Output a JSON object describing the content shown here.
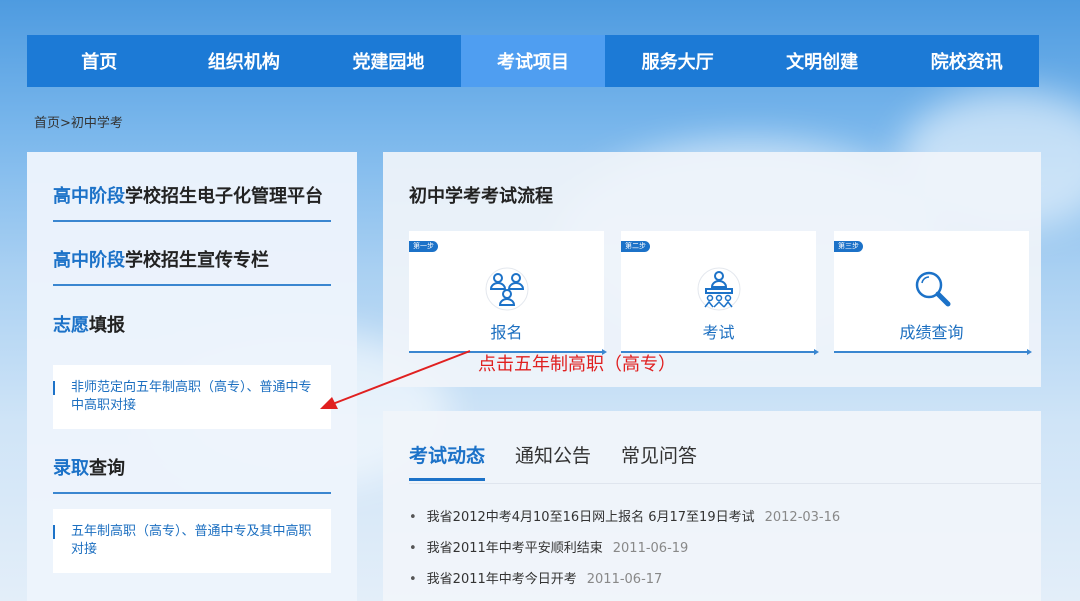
{
  "nav": {
    "items": [
      {
        "label": "首页"
      },
      {
        "label": "组织机构"
      },
      {
        "label": "党建园地"
      },
      {
        "label": "考试项目"
      },
      {
        "label": "服务大厅"
      },
      {
        "label": "文明创建"
      },
      {
        "label": "院校资讯"
      }
    ],
    "active_index": 3
  },
  "breadcrumb": "首页>初中学考",
  "sidebar": {
    "platform": {
      "highlight": "高中阶段",
      "rest": "学校招生电子化管理平台"
    },
    "promo": {
      "highlight": "高中阶段",
      "rest": "学校招生宣传专栏"
    },
    "volunteer": {
      "highlight": "志愿",
      "rest": "填报"
    },
    "volunteer_link": "非师范定向五年制高职（高专）、普通中专中高职对接",
    "admission": {
      "highlight": "录取",
      "rest": "查询"
    },
    "admission_link": "五年制高职（高专）、普通中专及其中高职对接"
  },
  "process": {
    "title": "初中学考考试流程",
    "steps": [
      {
        "badge": "第一步",
        "label": "报名",
        "icon": "users-icon"
      },
      {
        "badge": "第二步",
        "label": "考试",
        "icon": "exam-icon"
      },
      {
        "badge": "第三步",
        "label": "成绩查询",
        "icon": "magnifier-icon"
      }
    ]
  },
  "annotation": "点击五年制高职（高专）",
  "news": {
    "tabs": [
      "考试动态",
      "通知公告",
      "常见问答"
    ],
    "items": [
      {
        "title": "我省2012中考4月10至16日网上报名 6月17至19日考试",
        "date": "2012-03-16"
      },
      {
        "title": "我省2011年中考平安顺利结束",
        "date": "2011-06-19"
      },
      {
        "title": "我省2011年中考今日开考",
        "date": "2011-06-17"
      }
    ]
  },
  "colors": {
    "primary": "#1c7ad6",
    "active_nav": "#4f9ef1",
    "link": "#1c6fc0",
    "annotation": "#e02020"
  }
}
